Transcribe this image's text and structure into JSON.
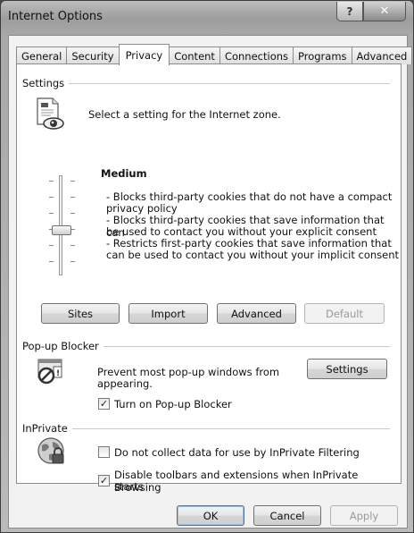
{
  "window": {
    "title": "Internet Options",
    "help_label": "?",
    "close_label": "✕"
  },
  "tabs": [
    {
      "label": "General",
      "active": false
    },
    {
      "label": "Security",
      "active": false
    },
    {
      "label": "Privacy",
      "active": true
    },
    {
      "label": "Content",
      "active": false
    },
    {
      "label": "Connections",
      "active": false
    },
    {
      "label": "Programs",
      "active": false
    },
    {
      "label": "Advanced",
      "active": false
    }
  ],
  "settings": {
    "group_label": "Settings",
    "instruction": "Select a setting for the Internet zone.",
    "level": "Medium",
    "desc_lines": [
      "- Blocks third-party cookies that do not have a compact",
      "privacy policy",
      "- Blocks third-party cookies that save information that can",
      "be used to contact you without your explicit consent",
      "- Restricts first-party cookies that save information that",
      "can be used to contact you without your implicit consent"
    ],
    "buttons": {
      "sites": "Sites",
      "import": "Import",
      "advanced": "Advanced",
      "default": "Default"
    },
    "icon": "privacy-document-eye-icon"
  },
  "popup": {
    "group_label": "Pop-up Blocker",
    "desc_lines": [
      "Prevent most pop-up windows from",
      "appearing."
    ],
    "settings_button": "Settings",
    "checkbox_label": "Turn on Pop-up Blocker",
    "checked": true,
    "icon": "popup-blocked-icon"
  },
  "inprivate": {
    "group_label": "InPrivate",
    "checkbox1_label": "Do not collect data for use by InPrivate Filtering",
    "checkbox1_checked": false,
    "checkbox2_lines": [
      "Disable toolbars and extensions when InPrivate Browsing",
      "starts"
    ],
    "checkbox2_checked": true,
    "icon": "inprivate-globe-lock-icon"
  },
  "footer": {
    "ok": "OK",
    "cancel": "Cancel",
    "apply": "Apply"
  },
  "check_glyph": "✓"
}
